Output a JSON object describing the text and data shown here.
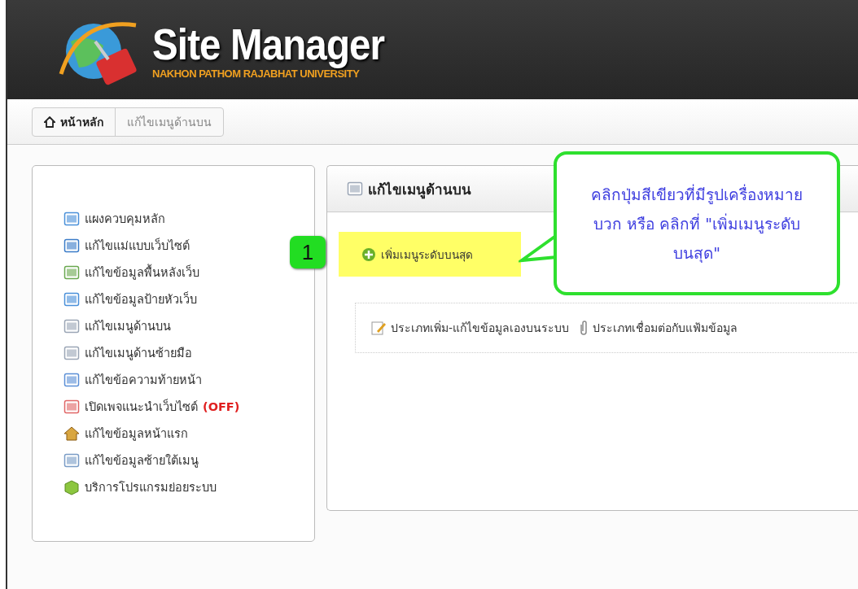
{
  "header": {
    "title": "Site Manager",
    "subtitle": "NAKHON PATHOM RAJABHAT UNIVERSITY"
  },
  "breadcrumb": [
    {
      "label": "หน้าหลัก",
      "selected": true
    },
    {
      "label": "แก้ไขเมนูด้านบน",
      "selected": false
    }
  ],
  "sidebar": {
    "items": [
      {
        "label": "แผงควบคุมหลัก"
      },
      {
        "label": "แก้ไขแม่แบบเว็บไซต์"
      },
      {
        "label": "แก้ไขข้อมูลพื้นหลังเว็บ"
      },
      {
        "label": "แก้ไขข้อมูลป้ายหัวเว็บ"
      },
      {
        "label": "แก้ไขเมนูด้านบน"
      },
      {
        "label": "แก้ไขเมนูด้านซ้ายมือ"
      },
      {
        "label": "แก้ไขข้อความท้ายหน้า"
      },
      {
        "label": "เปิดเพจแนะนำเว็บไซต์",
        "status": "(OFF)"
      },
      {
        "label": "แก้ไขข้อมูลหน้าแรก"
      },
      {
        "label": "แก้ไขข้อมูลซ้ายใต้เมนู"
      },
      {
        "label": "บริการโปรแกรมย่อยระบบ"
      }
    ]
  },
  "panel": {
    "title": "แก้ไขเมนูด้านบน",
    "add_button": "เพิ่มเมนูระดับบนสุด",
    "types": [
      "ประเภทเพิ่ม-แก้ไขข้อมูลเองบนระบบ",
      "ประเภทเชื่อมต่อกับแฟ้มข้อมูล"
    ]
  },
  "annotation": {
    "step": "1",
    "callout": "คลิกปุ่มสีเขียวที่มีรูปเครื่องหมายบวก หรือ คลิกที่ \"เพิ่มเมนูระดับบนสุด\""
  }
}
